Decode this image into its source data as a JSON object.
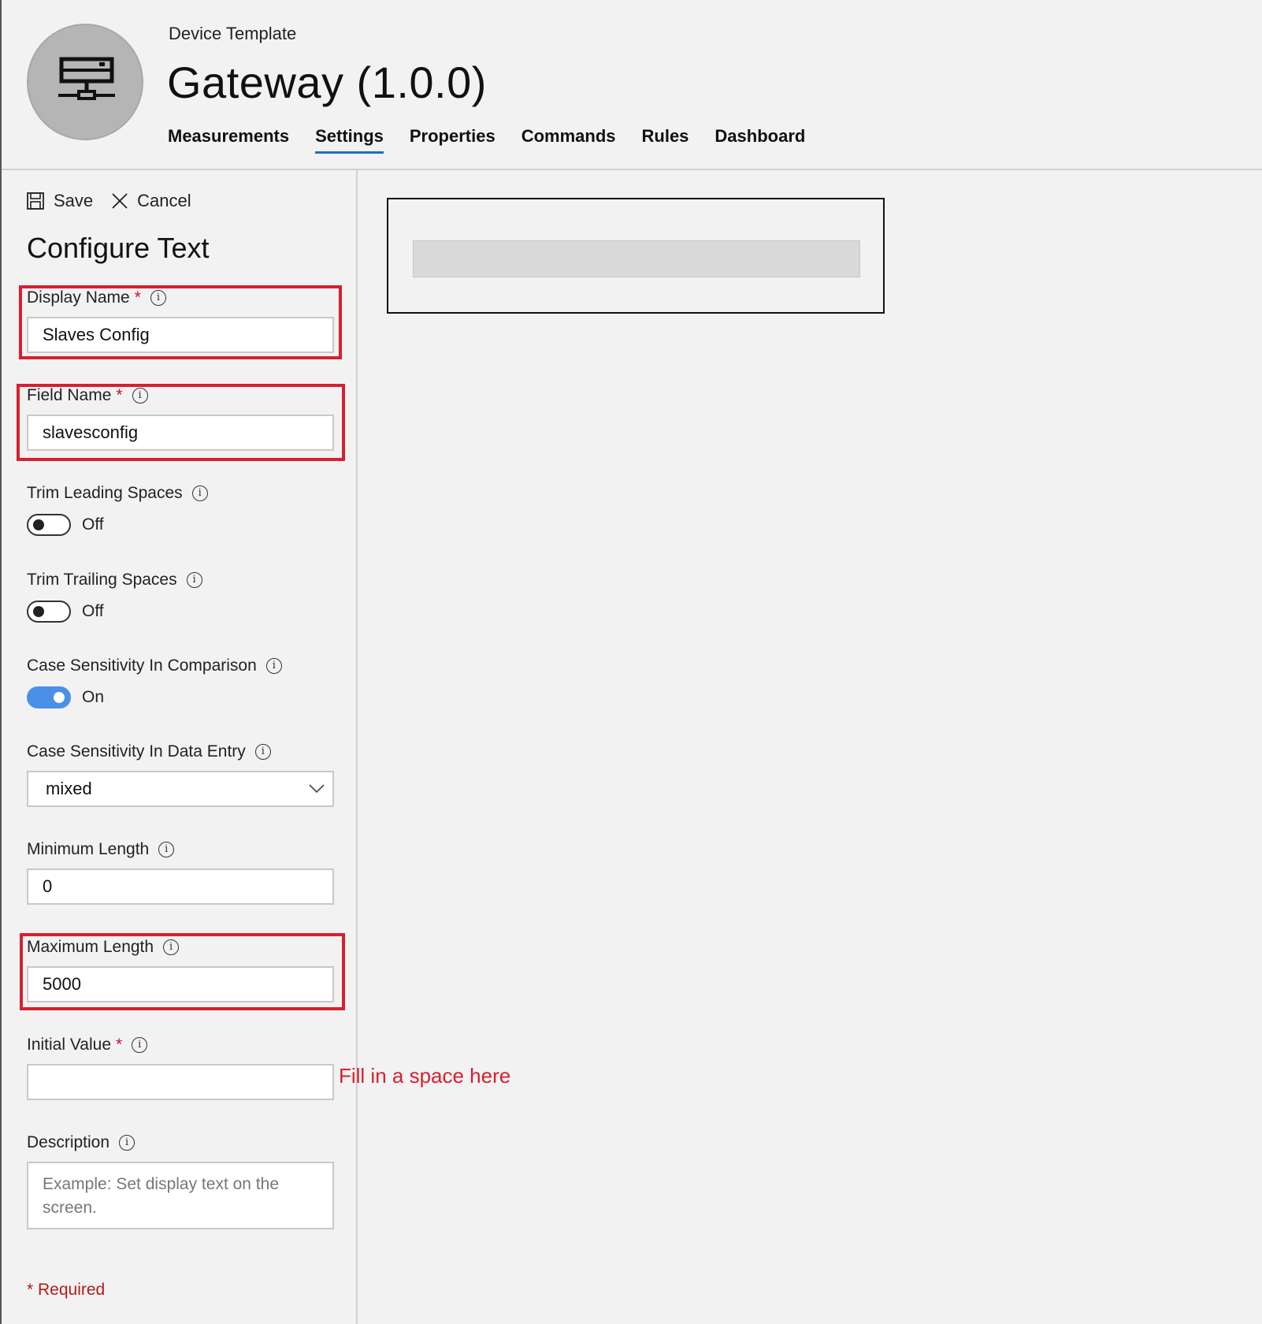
{
  "header": {
    "kicker": "Device Template",
    "title": "Gateway  (1.0.0)",
    "tabs": [
      {
        "label": "Measurements"
      },
      {
        "label": "Settings"
      },
      {
        "label": "Properties"
      },
      {
        "label": "Commands"
      },
      {
        "label": "Rules"
      },
      {
        "label": "Dashboard"
      }
    ],
    "active_tab": "Settings",
    "avatar_icon": "gateway-device-icon"
  },
  "toolbar": {
    "save_label": "Save",
    "cancel_label": "Cancel"
  },
  "panel": {
    "title": "Configure Text",
    "display_name": {
      "label": "Display Name",
      "required": "*",
      "value": "Slaves Config"
    },
    "field_name": {
      "label": "Field Name",
      "required": "*",
      "value": "slavesconfig"
    },
    "trim_leading": {
      "label": "Trim Leading Spaces",
      "state": "Off"
    },
    "trim_trailing": {
      "label": "Trim Trailing Spaces",
      "state": "Off"
    },
    "case_comparison": {
      "label": "Case Sensitivity In Comparison",
      "state": "On"
    },
    "case_entry": {
      "label": "Case Sensitivity In Data Entry",
      "value": "mixed"
    },
    "min_length": {
      "label": "Minimum Length",
      "value": "0"
    },
    "max_length": {
      "label": "Maximum Length",
      "value": "5000"
    },
    "initial_value": {
      "label": "Initial Value",
      "required": "*",
      "value": ""
    },
    "description": {
      "label": "Description",
      "placeholder": "Example: Set display text on the screen."
    },
    "required_note": "* Required"
  },
  "annotation": {
    "hint": "Fill in a space here",
    "color": "#d7202f"
  },
  "colors": {
    "accent": "#1a6fc4",
    "toggle_on": "#4a90e8"
  }
}
